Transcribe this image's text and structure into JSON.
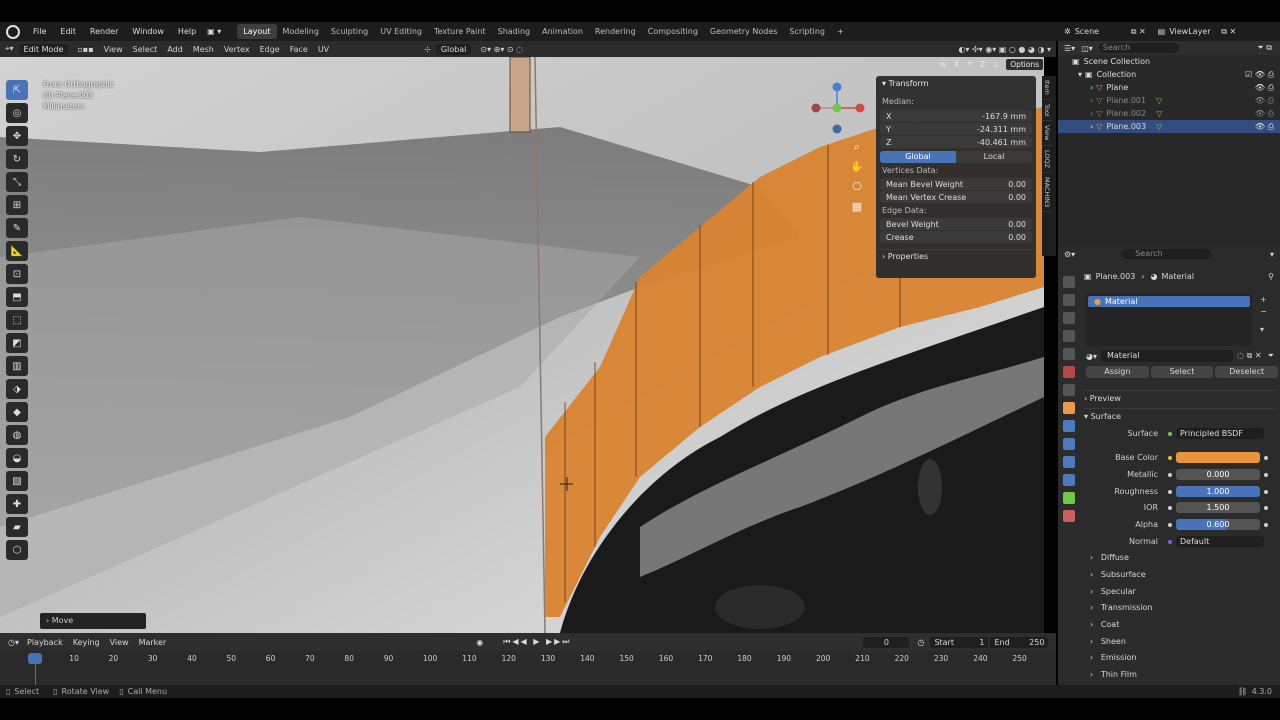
{
  "topbar": {
    "menus": [
      "File",
      "Edit",
      "Render",
      "Window",
      "Help"
    ],
    "workspaces": [
      "Layout",
      "Modeling",
      "Sculpting",
      "UV Editing",
      "Texture Paint",
      "Shading",
      "Animation",
      "Rendering",
      "Compositing",
      "Geometry Nodes",
      "Scripting"
    ],
    "active_workspace": "Layout",
    "add_tab": "+",
    "scene": "Scene",
    "view_layer": "ViewLayer"
  },
  "viewport_header": {
    "mode": "Edit Mode",
    "menus": [
      "View",
      "Select",
      "Add",
      "Mesh",
      "Vertex",
      "Edge",
      "Face",
      "UV"
    ],
    "orientation": "Global"
  },
  "viewport": {
    "view_name": "Front Orthographic",
    "object_info": "(0) Plane.003",
    "units": "Millimeters",
    "gizmo": {
      "x": "X",
      "y": "Y",
      "z": "Z"
    },
    "axis_lock": [
      "X",
      "Y",
      "Z"
    ],
    "options": "Options",
    "last_op": "Move"
  },
  "npanel": {
    "title": "Transform",
    "median_label": "Median:",
    "x_label": "X",
    "x_value": "-167.9 mm",
    "y_label": "Y",
    "y_value": "-24.311 mm",
    "z_label": "Z",
    "z_value": "-40.461 mm",
    "global": "Global",
    "local": "Local",
    "vertices_data": "Vertices Data:",
    "mean_bevel_weight": "Mean Bevel Weight",
    "mean_bevel_weight_value": "0.00",
    "mean_vertex_crease": "Mean Vertex Crease",
    "mean_vertex_crease_value": "0.00",
    "edge_data": "Edge Data:",
    "bevel_weight": "Bevel Weight",
    "bevel_weight_value": "0.00",
    "crease": "Crease",
    "crease_value": "0.00",
    "properties": "Properties",
    "tabs": [
      "Item",
      "Tool",
      "View",
      "LOQZ",
      "MACHIN3"
    ]
  },
  "outliner": {
    "search_placeholder": "Search",
    "items": [
      {
        "label": "Scene Collection"
      },
      {
        "label": "Collection"
      },
      {
        "label": "Plane"
      },
      {
        "label": "Plane.001"
      },
      {
        "label": "Plane.002"
      },
      {
        "label": "Plane.003"
      }
    ]
  },
  "properties": {
    "search_placeholder": "Search",
    "breadcrumb_object": "Plane.003",
    "breadcrumb_material": "Material",
    "slot_name": "Material",
    "material_name": "Material",
    "assign": "Assign",
    "select": "Select",
    "deselect": "Deselect",
    "preview": "Preview",
    "surface_section": "Surface",
    "surface_label": "Surface",
    "surface_value": "Principled BSDF",
    "base_color_label": "Base Color",
    "base_color": "#e8953a",
    "metallic_label": "Metallic",
    "metallic_value": "0.000",
    "roughness_label": "Roughness",
    "roughness_value": "1.000",
    "ior_label": "IOR",
    "ior_value": "1.500",
    "alpha_label": "Alpha",
    "alpha_value": "0.600",
    "normal_label": "Normal",
    "normal_value": "Default",
    "subsections": [
      "Diffuse",
      "Subsurface",
      "Specular",
      "Transmission",
      "Coat",
      "Sheen",
      "Emission",
      "Thin Film"
    ]
  },
  "timeline": {
    "menus": [
      "Playback",
      "Keying",
      "View",
      "Marker"
    ],
    "current_frame": "0",
    "start_label": "Start",
    "start_value": "1",
    "end_label": "End",
    "end_value": "250",
    "ticks": [
      "0",
      "10",
      "20",
      "30",
      "40",
      "50",
      "60",
      "70",
      "80",
      "90",
      "100",
      "110",
      "120",
      "130",
      "140",
      "150",
      "160",
      "170",
      "180",
      "190",
      "200",
      "210",
      "220",
      "230",
      "240",
      "250"
    ]
  },
  "statusbar": {
    "select": "Select",
    "rotate": "Rotate View",
    "call_menu": "Call Menu",
    "version": "4.3.0"
  },
  "colors": {
    "accent": "#4873b8",
    "orange_mesh": "#d98432",
    "selection": "#334d80"
  }
}
